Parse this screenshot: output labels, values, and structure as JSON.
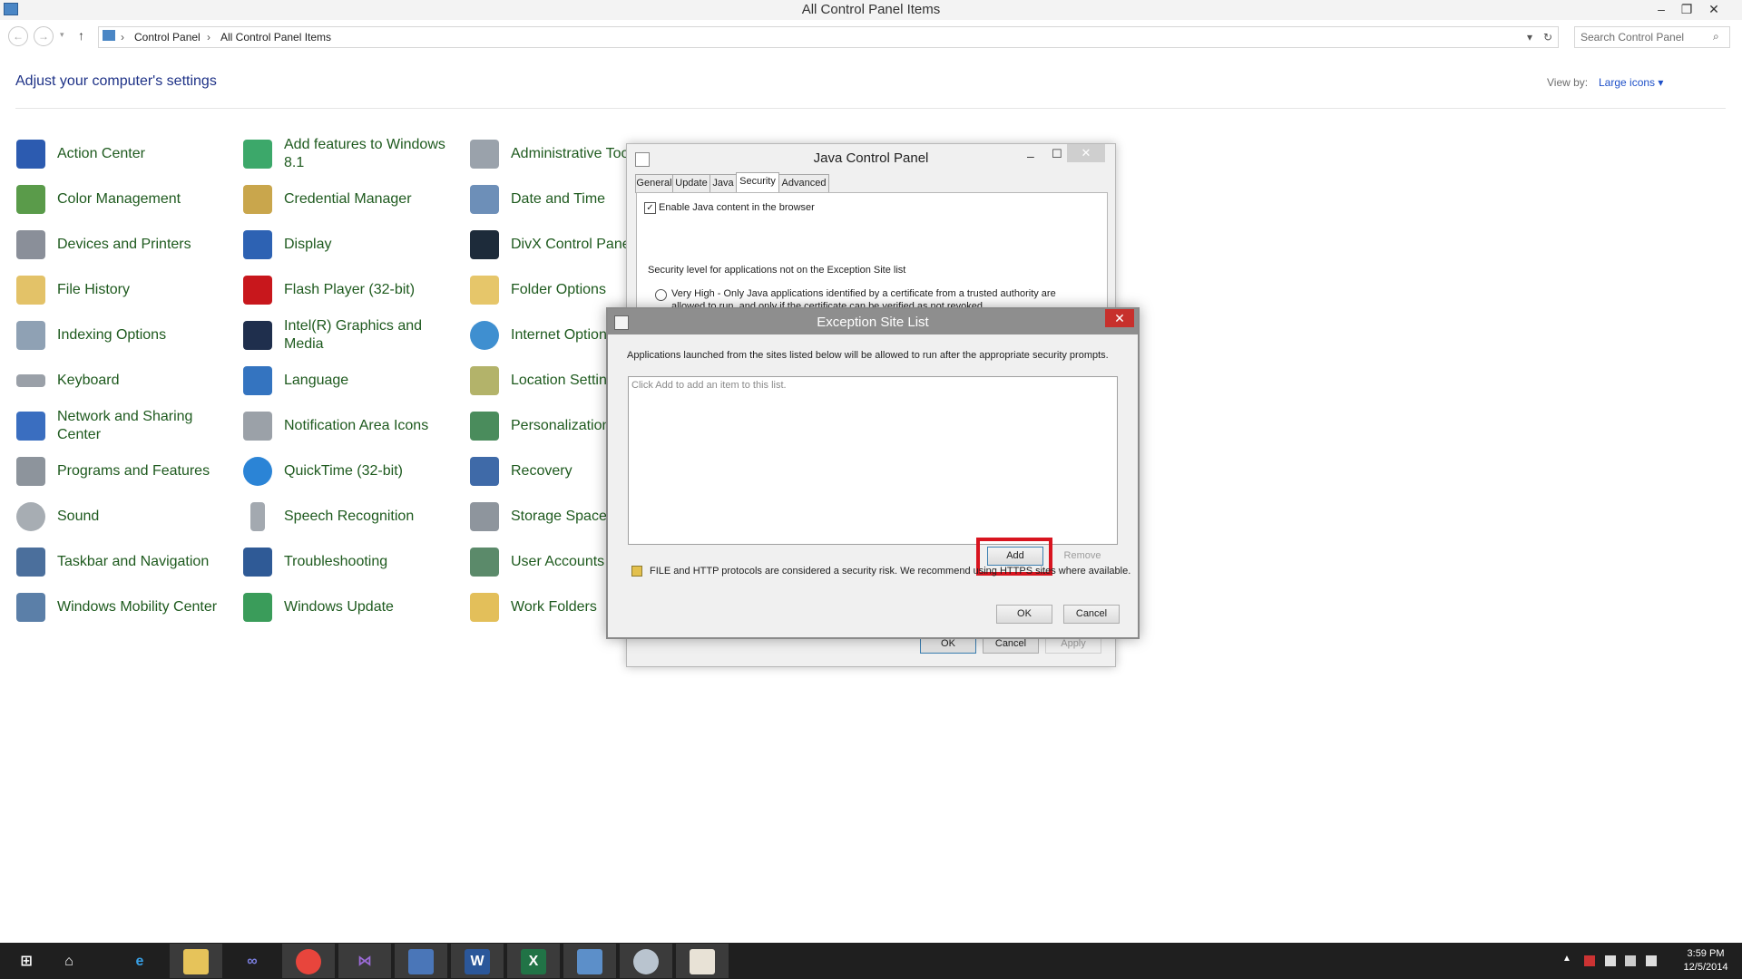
{
  "window": {
    "title": "All Control Panel Items",
    "minimize": "–",
    "restore": "❐",
    "close": "✕"
  },
  "address": {
    "crumbs": [
      "Control Panel",
      "All Control Panel Items"
    ],
    "search_placeholder": "Search Control Panel"
  },
  "content": {
    "heading": "Adjust your computer's settings",
    "view_by_label": "View by:",
    "view_by_value": "Large icons ▾"
  },
  "items": {
    "col1": [
      "Action Center",
      "Color Management",
      "Devices and Printers",
      "File History",
      "Indexing Options",
      "Keyboard",
      "Network and Sharing Center",
      "Programs and Features",
      "Sound",
      "Taskbar and Navigation",
      "Windows Mobility Center"
    ],
    "col2": [
      "Add features to Windows 8.1",
      "Credential Manager",
      "Display",
      "Flash Player (32-bit)",
      "Intel(R) Graphics and Media",
      "Language",
      "Notification Area Icons",
      "QuickTime (32-bit)",
      "Speech Recognition",
      "Troubleshooting",
      "Windows Update"
    ],
    "col3": [
      "Administrative Tools",
      "Date and Time",
      "DivX Control Panel",
      "Folder Options",
      "Internet Options",
      "Location Settings",
      "Personalization",
      "Recovery",
      "Storage Spaces",
      "User Accounts",
      "Work Folders"
    ]
  },
  "java_panel": {
    "title": "Java Control Panel",
    "tabs": [
      "General",
      "Update",
      "Java",
      "Security",
      "Advanced"
    ],
    "active_tab": "Security",
    "enable_java_label": "Enable Java content in the browser",
    "enable_java_checked": true,
    "security_level_label": "Security level for applications not on the Exception Site list",
    "very_high_text": "Very High - Only Java applications identified by a certificate from a trusted authority are",
    "very_high_text_2": "allowed to run, and only if the certificate can be verified as not revoked.",
    "ok": "OK",
    "cancel": "Cancel",
    "apply": "Apply"
  },
  "exception_dialog": {
    "title": "Exception Site List",
    "description": "Applications launched from the sites listed below will be allowed to run after the appropriate security prompts.",
    "list_hint": "Click Add to add an item to this list.",
    "add": "Add",
    "remove": "Remove",
    "warning": "FILE and HTTP protocols are considered a security risk.  We recommend using HTTPS sites where available.",
    "ok": "OK",
    "cancel": "Cancel"
  },
  "taskbar": {
    "time": "3:59 PM",
    "date": "12/5/2014"
  },
  "colors": {
    "link_green": "#1e5a1e",
    "heading_blue": "#1e3287",
    "highlight_red": "#d8141f",
    "taskbar": "#1f1f1f"
  }
}
